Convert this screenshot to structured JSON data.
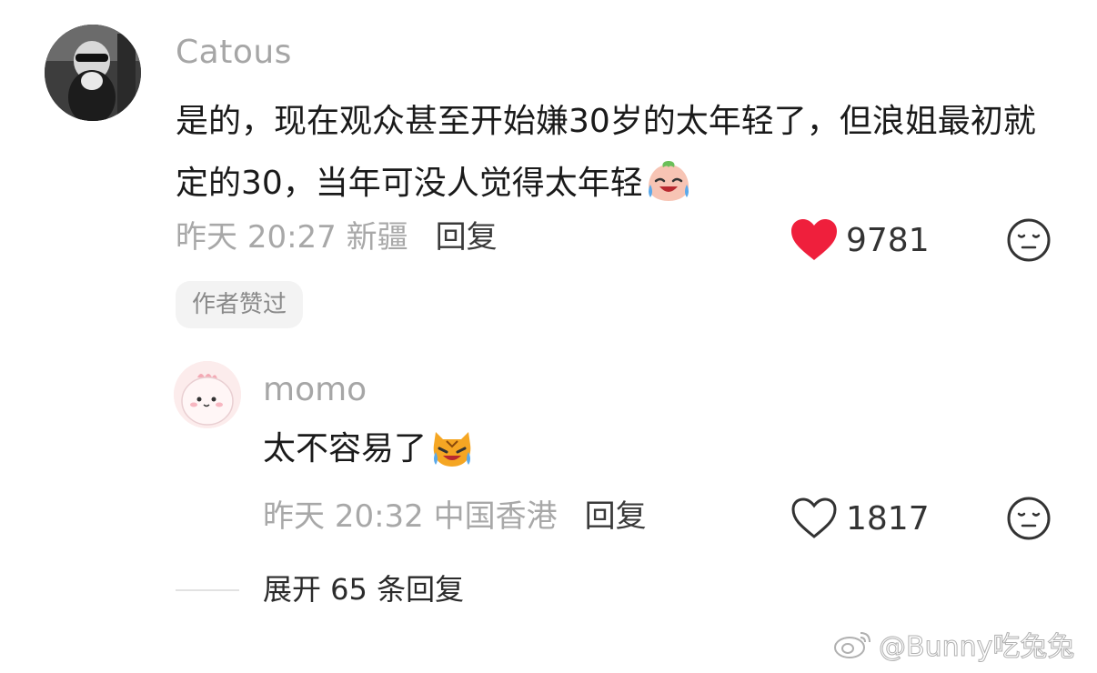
{
  "main_comment": {
    "author": "Catous",
    "text": "是的，现在观众甚至开始嫌30岁的太年轻了，但浪姐最初就定的30，当年可没人觉得太年轻",
    "emoji": "crying-laughing-peach-emoji",
    "date": "昨天",
    "time": "20:27",
    "location": "新疆",
    "reply_label": "回复",
    "likes": "9781",
    "liked": true,
    "badge": "作者赞过"
  },
  "reply_comment": {
    "author": "momo",
    "text": "太不容易了",
    "emoji": "crying-tiger-emoji",
    "date": "昨天",
    "time": "20:32",
    "location": "中国香港",
    "reply_label": "回复",
    "likes": "1817",
    "liked": false
  },
  "expand": {
    "label": "展开 65 条回复"
  },
  "watermark": {
    "text": "@Bunny吃兔兔"
  },
  "colors": {
    "like_red": "#ef1f3c",
    "muted_text": "#a8a8a8",
    "badge_bg": "#f3f3f3"
  }
}
